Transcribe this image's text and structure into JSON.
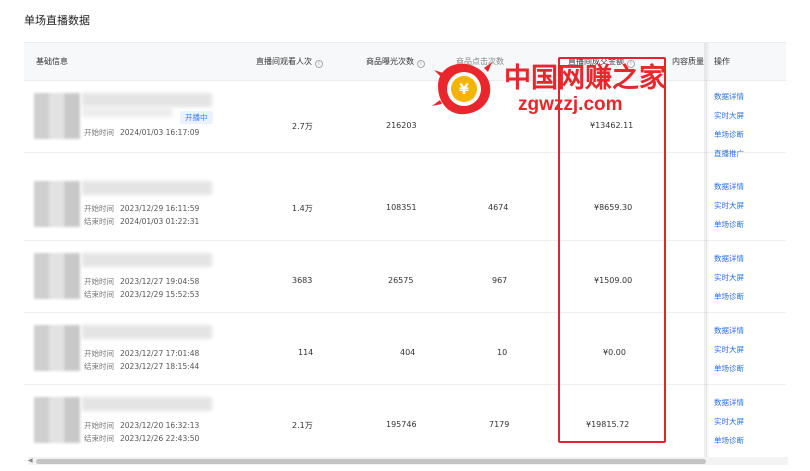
{
  "page": {
    "title": "单场直播数据"
  },
  "table": {
    "headers": {
      "basic": "基础信息",
      "viewers": "直播间观看人次",
      "exposure": "商品曝光次数",
      "clicks": "商品点击次数",
      "gmv": "直播间成交金额",
      "quality": "内容质量",
      "ops": "操作"
    },
    "rows": [
      {
        "status": "开播中",
        "start_label": "开始时间",
        "start": "2024/01/03 16:17:09",
        "end_label": "",
        "end": "",
        "viewers": "2.7万",
        "exposure": "216203",
        "clicks": "",
        "gmv": "¥13462.11",
        "ops": [
          "数据详情",
          "实时大屏",
          "单场诊断",
          "直播推广"
        ]
      },
      {
        "status": "",
        "start_label": "开始时间",
        "start": "2023/12/29 16:11:59",
        "end_label": "结束时间",
        "end": "2024/01/03 01:22:31",
        "viewers": "1.4万",
        "exposure": "108351",
        "clicks": "4674",
        "gmv": "¥8659.30",
        "ops": [
          "数据详情",
          "实时大屏",
          "单场诊断"
        ]
      },
      {
        "status": "",
        "start_label": "开始时间",
        "start": "2023/12/27 19:04:58",
        "end_label": "结束时间",
        "end": "2023/12/29 15:52:53",
        "viewers": "3683",
        "exposure": "26575",
        "clicks": "967",
        "gmv": "¥1509.00",
        "ops": [
          "数据详情",
          "实时大屏",
          "单场诊断"
        ]
      },
      {
        "status": "",
        "start_label": "开始时间",
        "start": "2023/12/27 17:01:48",
        "end_label": "结束时间",
        "end": "2023/12/27 18:15:44",
        "viewers": "114",
        "exposure": "404",
        "clicks": "10",
        "gmv": "¥0.00",
        "ops": [
          "数据详情",
          "实时大屏",
          "单场诊断"
        ]
      },
      {
        "status": "",
        "start_label": "开始时间",
        "start": "2023/12/20 16:32:13",
        "end_label": "结束时间",
        "end": "2023/12/26 22:43:50",
        "viewers": "2.1万",
        "exposure": "195746",
        "clicks": "7179",
        "gmv": "¥19815.72",
        "ops": [
          "数据详情",
          "实时大屏",
          "单场诊断"
        ]
      }
    ]
  },
  "watermark": {
    "cn": "中国网赚之家",
    "en": "zgwzzj.com",
    "logo_char": "¥"
  },
  "colors": {
    "link": "#2b6fe0",
    "highlight": "#e0262a",
    "watermark": "#e8262b"
  }
}
